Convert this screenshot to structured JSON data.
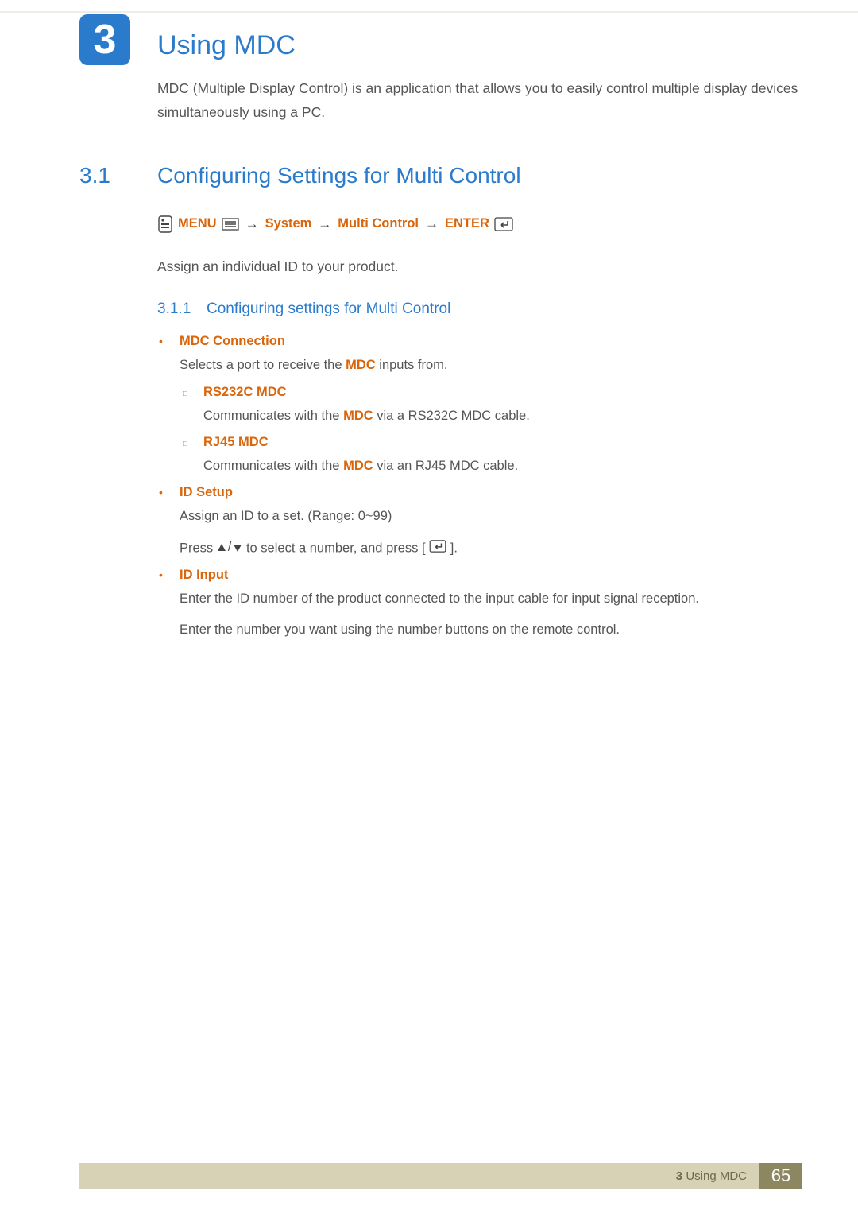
{
  "chapter": {
    "number": "3",
    "title": "Using MDC",
    "intro": "MDC (Multiple Display Control) is an application that allows you to easily control multiple display devices simultaneously using a PC."
  },
  "section": {
    "number": "3.1",
    "title": "Configuring Settings for Multi Control",
    "menu_path": {
      "menu": "MENU",
      "step1": "System",
      "step2": "Multi Control",
      "enter": "ENTER"
    },
    "assign_text": "Assign an individual ID to your product."
  },
  "subsection": {
    "number": "3.1.1",
    "title": "Configuring settings for Multi Control"
  },
  "items": {
    "mdc_connection": {
      "label": "MDC Connection",
      "desc_prefix": "Selects a port to receive the ",
      "desc_bold": "MDC",
      "desc_suffix": " inputs from.",
      "sub": {
        "rs232c": {
          "label": "RS232C MDC",
          "desc_prefix": "Communicates with the ",
          "desc_bold": "MDC",
          "desc_suffix": " via a RS232C MDC cable."
        },
        "rj45": {
          "label": "RJ45 MDC",
          "desc_prefix": "Communicates with the ",
          "desc_bold": "MDC",
          "desc_suffix": " via an RJ45 MDC cable."
        }
      }
    },
    "id_setup": {
      "label": "ID Setup",
      "desc1": "Assign an ID to a set. (Range: 0~99)",
      "desc2_prefix": "Press ",
      "desc2_suffix": " to select a number, and press [",
      "desc2_end": "]."
    },
    "id_input": {
      "label": "ID Input",
      "desc1": "Enter the ID number of the product connected to the input cable for input signal reception.",
      "desc2": "Enter the number you want using the number buttons on the remote control."
    }
  },
  "footer": {
    "chapter_num": "3",
    "chapter_title": "Using MDC",
    "page": "65"
  }
}
